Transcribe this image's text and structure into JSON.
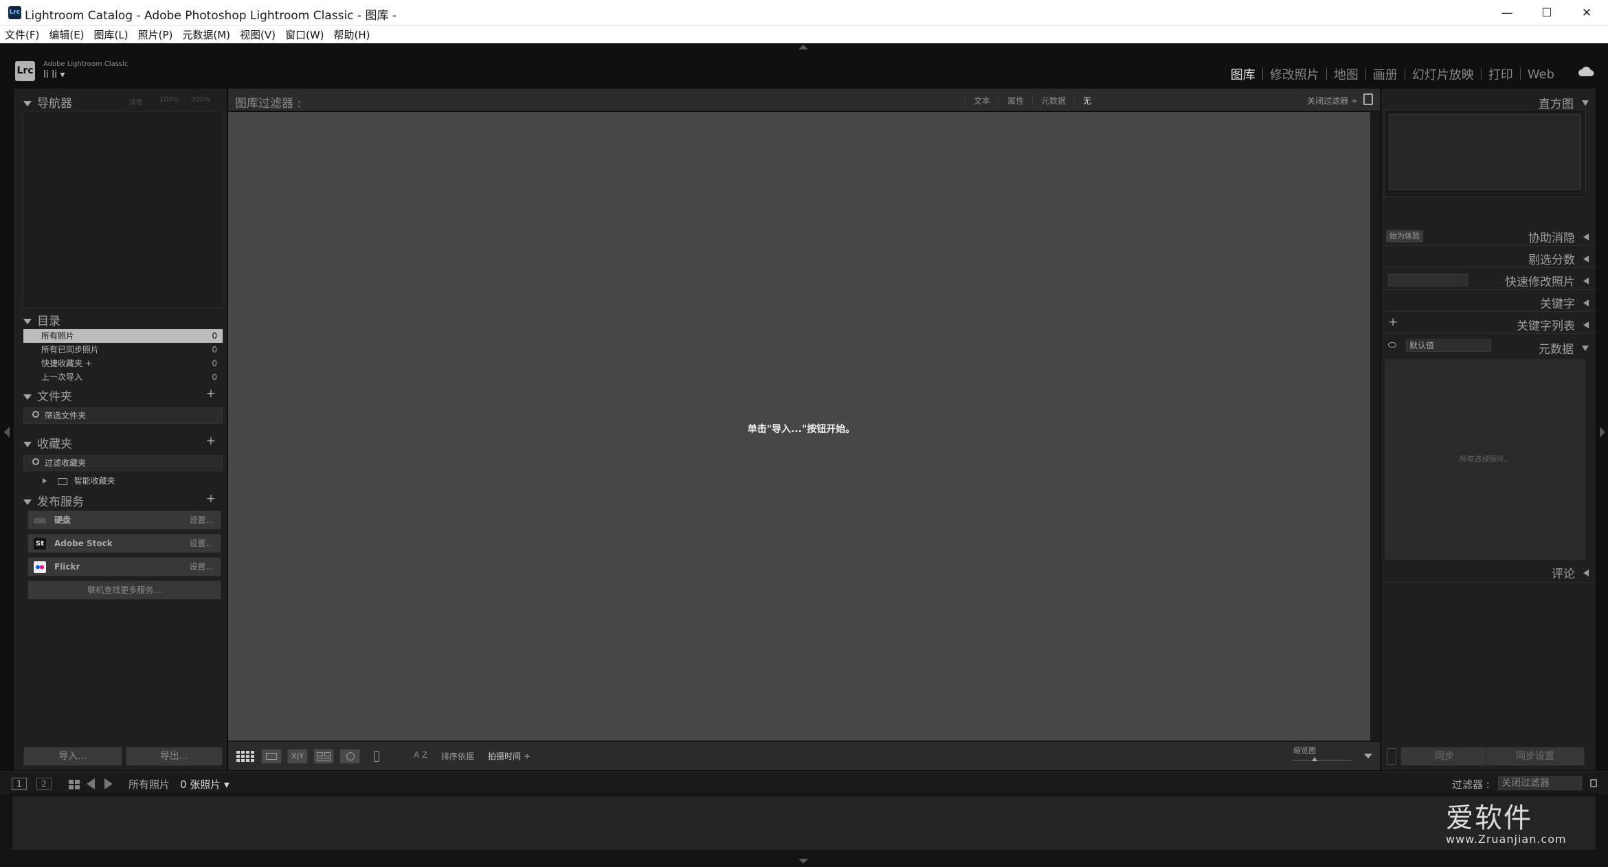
{
  "window": {
    "title": "Lightroom Catalog - Adobe Photoshop Lightroom Classic - 图库 -",
    "app_icon": "Lrc",
    "minimize": "—",
    "maximize": "☐",
    "close": "✕"
  },
  "menu": [
    "文件(F)",
    "编辑(E)",
    "图库(L)",
    "照片(P)",
    "元数据(M)",
    "视图(V)",
    "窗口(W)",
    "帮助(H)"
  ],
  "header": {
    "badge": "Lrc",
    "brand": "Adobe Lightroom Classic",
    "user": "li li  ▾",
    "modules": [
      "图库",
      "修改照片",
      "地图",
      "画册",
      "幻灯片放映",
      "打印",
      "Web"
    ],
    "active_module": "图库"
  },
  "left": {
    "navigator": {
      "title": "导航器",
      "opts": [
        "适合",
        "100%",
        "300%"
      ]
    },
    "catalog": {
      "title": "目录",
      "items": [
        {
          "label": "所有照片",
          "count": "0"
        },
        {
          "label": "所有已同步照片",
          "count": "0"
        },
        {
          "label": "快捷收藏夹 +",
          "count": "0"
        },
        {
          "label": "上一次导入",
          "count": "0"
        }
      ]
    },
    "folders": {
      "title": "文件夹",
      "plus": "+",
      "search": "筛选文件夹"
    },
    "collections": {
      "title": "收藏夹",
      "plus": "+",
      "search": "过滤收藏夹",
      "smart": "智能收藏夹"
    },
    "publish": {
      "title": "发布服务",
      "plus": "+",
      "items": [
        {
          "label": "硬盘",
          "setup": "设置..."
        },
        {
          "label": "Adobe Stock",
          "setup": "设置...",
          "icon_text": "St"
        },
        {
          "label": "Flickr",
          "setup": "设置..."
        }
      ],
      "more": "联机查找更多服务..."
    },
    "import_btn": "导入...",
    "export_btn": "导出..."
  },
  "center": {
    "filter_title": "图库过滤器 :",
    "filter_opts": [
      "文本",
      "属性",
      "元数据",
      "无"
    ],
    "filter_active": "无",
    "filter_close": "关闭过滤器 ÷",
    "empty_message": "单击\"导入...\"按钮开始。",
    "sort_label": "排序依据",
    "sort_value": "拍摄时间 ÷",
    "thumb_label": "缩览图",
    "xy": "X|Y",
    "az_icon": "A Z"
  },
  "right": {
    "histogram": "直方图",
    "original": "始为体验",
    "panels": [
      "协助消隐",
      "剔选分数",
      "快速修改照片",
      "关键字",
      "关键字列表",
      "元数据",
      "评论"
    ],
    "keyword_plus": "+",
    "meta_preset": "默认值",
    "meta_empty": "所有选择照片。",
    "sync_btn": "同步",
    "sync_settings_btn": "同步设置"
  },
  "filmstrip": {
    "page1": "1",
    "page2": "2",
    "source": "所有照片",
    "count": "0 张照片 ▾",
    "filter_label": "过滤器 :",
    "filter_value": "关闭过滤器"
  },
  "watermark": {
    "brand": "爱软件",
    "url": "www.Zruanjian.com"
  }
}
